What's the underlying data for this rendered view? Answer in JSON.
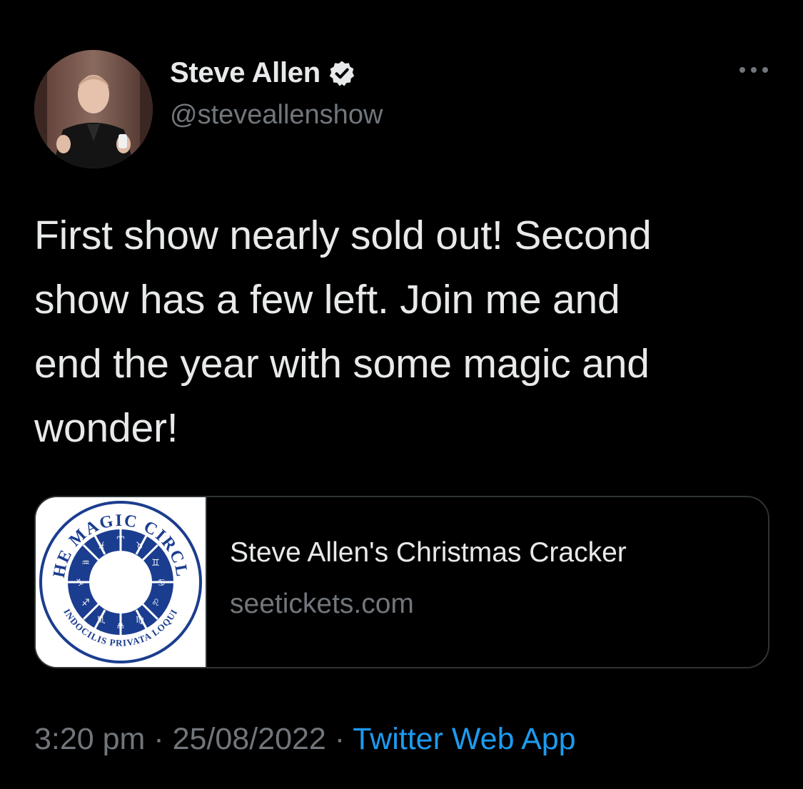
{
  "author": {
    "display_name": "Steve Allen",
    "handle": "@steveallenshow",
    "verified": true
  },
  "tweet": {
    "text_lines": [
      "First show nearly sold out! Second",
      "show has a few left. Join me and",
      "end the year with some magic and",
      "wonder!"
    ]
  },
  "card": {
    "title": "Steve Allen's Christmas Cracker",
    "domain": "seetickets.com",
    "logo_text_top": "THE MAGIC CIRCLE",
    "logo_text_bottom": "INDOCILIS PRIVATA LOQUI"
  },
  "meta": {
    "time": "3:20 pm",
    "separator": "·",
    "date": "25/08/2022",
    "source": "Twitter Web App"
  },
  "icons": {
    "verified": "verified-badge-icon",
    "more": "more-horizontal-icon"
  },
  "colors": {
    "background": "#000000",
    "primary_text": "#e7e9ea",
    "secondary_text": "#71767b",
    "link": "#1d9bf0",
    "border": "#2f3336",
    "logo_blue": "#1b3d8f"
  }
}
